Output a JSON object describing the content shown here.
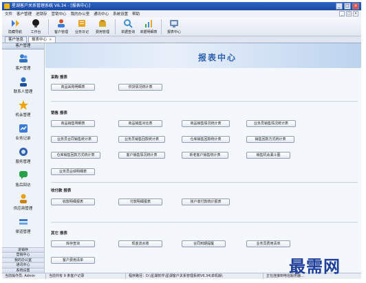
{
  "window": {
    "title": "星湖客户关系管理系统 V6.34 - [报表中心]",
    "buttons": [
      "_",
      "□",
      "×"
    ]
  },
  "menubar": {
    "items": [
      "文件",
      "客户管理",
      "进销存",
      "营销中心",
      "我的办公室",
      "通讯中心",
      "系统设置",
      "帮助"
    ],
    "mdi_buttons": [
      "_",
      "□",
      "×"
    ]
  },
  "toolbar": {
    "items": [
      {
        "label": "隐藏导航",
        "icon": "hide-nav-icon",
        "color": "#3b7ad9"
      },
      {
        "label": "工作台",
        "icon": "workbench-icon",
        "color": "#1a1a1a"
      },
      {
        "label": "客户管理",
        "icon": "customer-icon",
        "color": "#d9502a"
      },
      {
        "label": "业务日记",
        "icon": "diary-icon",
        "color": "#e8a522"
      },
      {
        "label": "费用管理",
        "icon": "expense-icon",
        "color": "#d9a72a"
      },
      {
        "label": "单据查询",
        "icon": "search-doc-icon",
        "color": "#3c8fd4"
      },
      {
        "label": "单据明细表",
        "icon": "detail-table-icon",
        "color": "#3aa34a"
      },
      {
        "label": "报表中心",
        "icon": "report-center-icon",
        "color": "#6a89b8"
      }
    ]
  },
  "tabs": [
    {
      "label": "客户信息",
      "active": false
    },
    {
      "label": "报表中心",
      "active": true,
      "close": "×"
    }
  ],
  "sidebar": {
    "header": "客户管理",
    "items": [
      {
        "label": "客户管理",
        "icon": "customers-icon",
        "color": "#3c7dd0"
      },
      {
        "label": "联系人管理",
        "icon": "contact-icon",
        "color": "#2f6fbf"
      },
      {
        "label": "机会管理",
        "icon": "star-icon",
        "color": "#f0a30a"
      },
      {
        "label": "业务记录",
        "icon": "record-icon",
        "color": "#3a7bd5"
      },
      {
        "label": "服务管理",
        "icon": "service-icon",
        "color": "#2d5fae"
      },
      {
        "label": "售后回访",
        "icon": "chat-icon",
        "color": "#27a04a"
      },
      {
        "label": "供应商管理",
        "icon": "supplier-icon",
        "color": "#e6a11a"
      },
      {
        "label": "渠道管理",
        "icon": "channel-icon",
        "color": "#3a78c8"
      }
    ],
    "groups": [
      "进销存",
      "营销中心",
      "我的办公室",
      "通讯中心",
      "系统设置"
    ]
  },
  "main": {
    "banner_title": "报表中心",
    "sections": [
      {
        "title": "采购 报表",
        "buttons": [
          "商品采购明细表",
          "供货情况统计表"
        ]
      },
      {
        "title": "销售 报表",
        "buttons": [
          "商品销售明细表",
          "商品销售对比表",
          "商品销售情况统计表",
          "业务员销售情况统计表",
          "业务员合同销售统计表",
          "业务员销售回款统计表",
          "仓库销售回款统计表",
          "销售回款方式统计表",
          "仓库销售回款方式统计表",
          "客户销售情况统计表",
          "新老客户销售统计表",
          "销售机会漏斗图",
          "业务员业绩明细表"
        ]
      },
      {
        "title": "收付款 报表",
        "buttons": [
          "收款明细报表",
          "付款明细报表",
          "账户收付款统计报表"
        ]
      },
      {
        "title": "其它 报表",
        "buttons": [
          "库存查询",
          "现金流水账",
          "合同到期提醒",
          "业务员费用清单",
          "客户费用清单"
        ]
      }
    ]
  },
  "statusbar": {
    "cells": [
      "当前操作员: Admin",
      "当前共有 9 条客户记录",
      "程序路径：D:\\星湖软件\\星湖客户关系管理系统V6.34\\单机版\\",
      "正在连接到电信服务器..."
    ]
  },
  "watermark": "最需网"
}
